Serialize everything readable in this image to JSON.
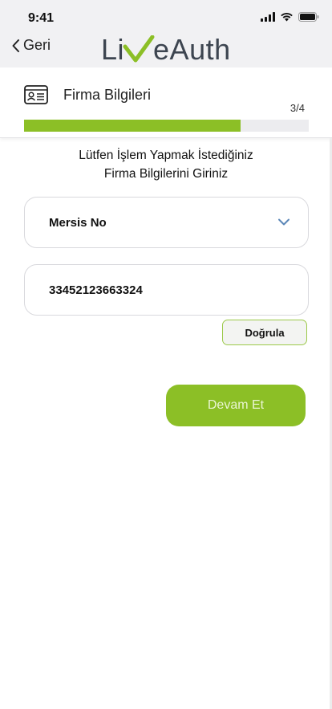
{
  "status_bar": {
    "time": "9:41"
  },
  "nav": {
    "back_label": "Geri"
  },
  "logo": {
    "text_left": "Li",
    "text_right": "eAuth"
  },
  "step_card": {
    "title": "Firma Bilgileri",
    "step": "3/4",
    "progress_fraction": 0.76
  },
  "instructions": {
    "line1": "Lütfen İşlem Yapmak İstediğiniz",
    "line2": "Firma Bilgilerini Giriniz"
  },
  "form": {
    "id_type_selected": "Mersis No",
    "id_value": "33452123663324",
    "verify_label": "Doğrula"
  },
  "actions": {
    "continue_label": "Devam Et"
  },
  "colors": {
    "accent": "#8cbf26",
    "top_background": "#f1f1f3",
    "logo_text": "#3d4550",
    "chevron": "#5b87b8"
  }
}
